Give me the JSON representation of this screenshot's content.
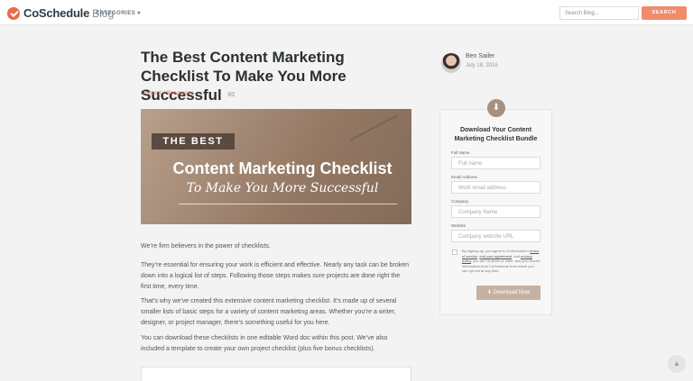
{
  "header": {
    "logo_text": "CoSchedule",
    "logo_suffix": "Blog",
    "categories_label": "CATEGORIES ▾",
    "search_placeholder": "Search Blog...",
    "search_button": "SEARCH"
  },
  "article": {
    "title": "The Best Content Marketing Checklist To Make You More Successful",
    "share_count": "80",
    "category_1": "Content",
    "category_sep": "/",
    "category_2": "Resources",
    "hero": {
      "badge": "THE BEST",
      "line1": "Content Marketing Checklist",
      "line2": "To Make You More Successful"
    },
    "paragraphs": [
      "We’re firm believers in the power of checklists.",
      "They’re essential for ensuring your work is efficient and effective. Nearly any task can be broken down into a logical list of steps. Following those steps makes sure projects are done right the first time, every time.",
      "That’s why we’ve created this extensive content marketing checklist. It’s made up of several smaller lists of basic steps for a variety of content marketing areas. Whether you’re a writer, designer, or project manager, there’s something useful for you here.",
      "You can download these checklists in one editable Word doc within this post. We’ve also included a template to create your own project checklist (plus five bonus checklists)."
    ]
  },
  "author": {
    "name": "Ben Sailer",
    "date": "July 18, 2016"
  },
  "form": {
    "title": "Download Your Content Marketing Checklist Bundle",
    "fields": [
      {
        "label": "Full Name",
        "placeholder": "Full name"
      },
      {
        "label": "Email Address",
        "placeholder": "Work email address"
      },
      {
        "label": "Company",
        "placeholder": "Company Name"
      },
      {
        "label": "Website",
        "placeholder": "Company website URL"
      }
    ],
    "terms_pre": "By signing up, you agree to CoSchedule's ",
    "terms_link1": "terms of service",
    "terms_mid1": ", ",
    "terms_link2": "end user agreement",
    "terms_mid2": ", and ",
    "terms_link3": "privacy policy",
    "terms_post": ", you are 16 years or older, and you receive information from CoSchedule from which you can opt out at any time.",
    "download_button": "Download Now"
  },
  "icons": {
    "logo": "check-circle-logo",
    "download": "download-icon",
    "scroll_top": "chevron-up-icon"
  },
  "colors": {
    "accent": "#f08c6c",
    "link": "#e46f4f",
    "form_button": "#c5b1a2"
  }
}
